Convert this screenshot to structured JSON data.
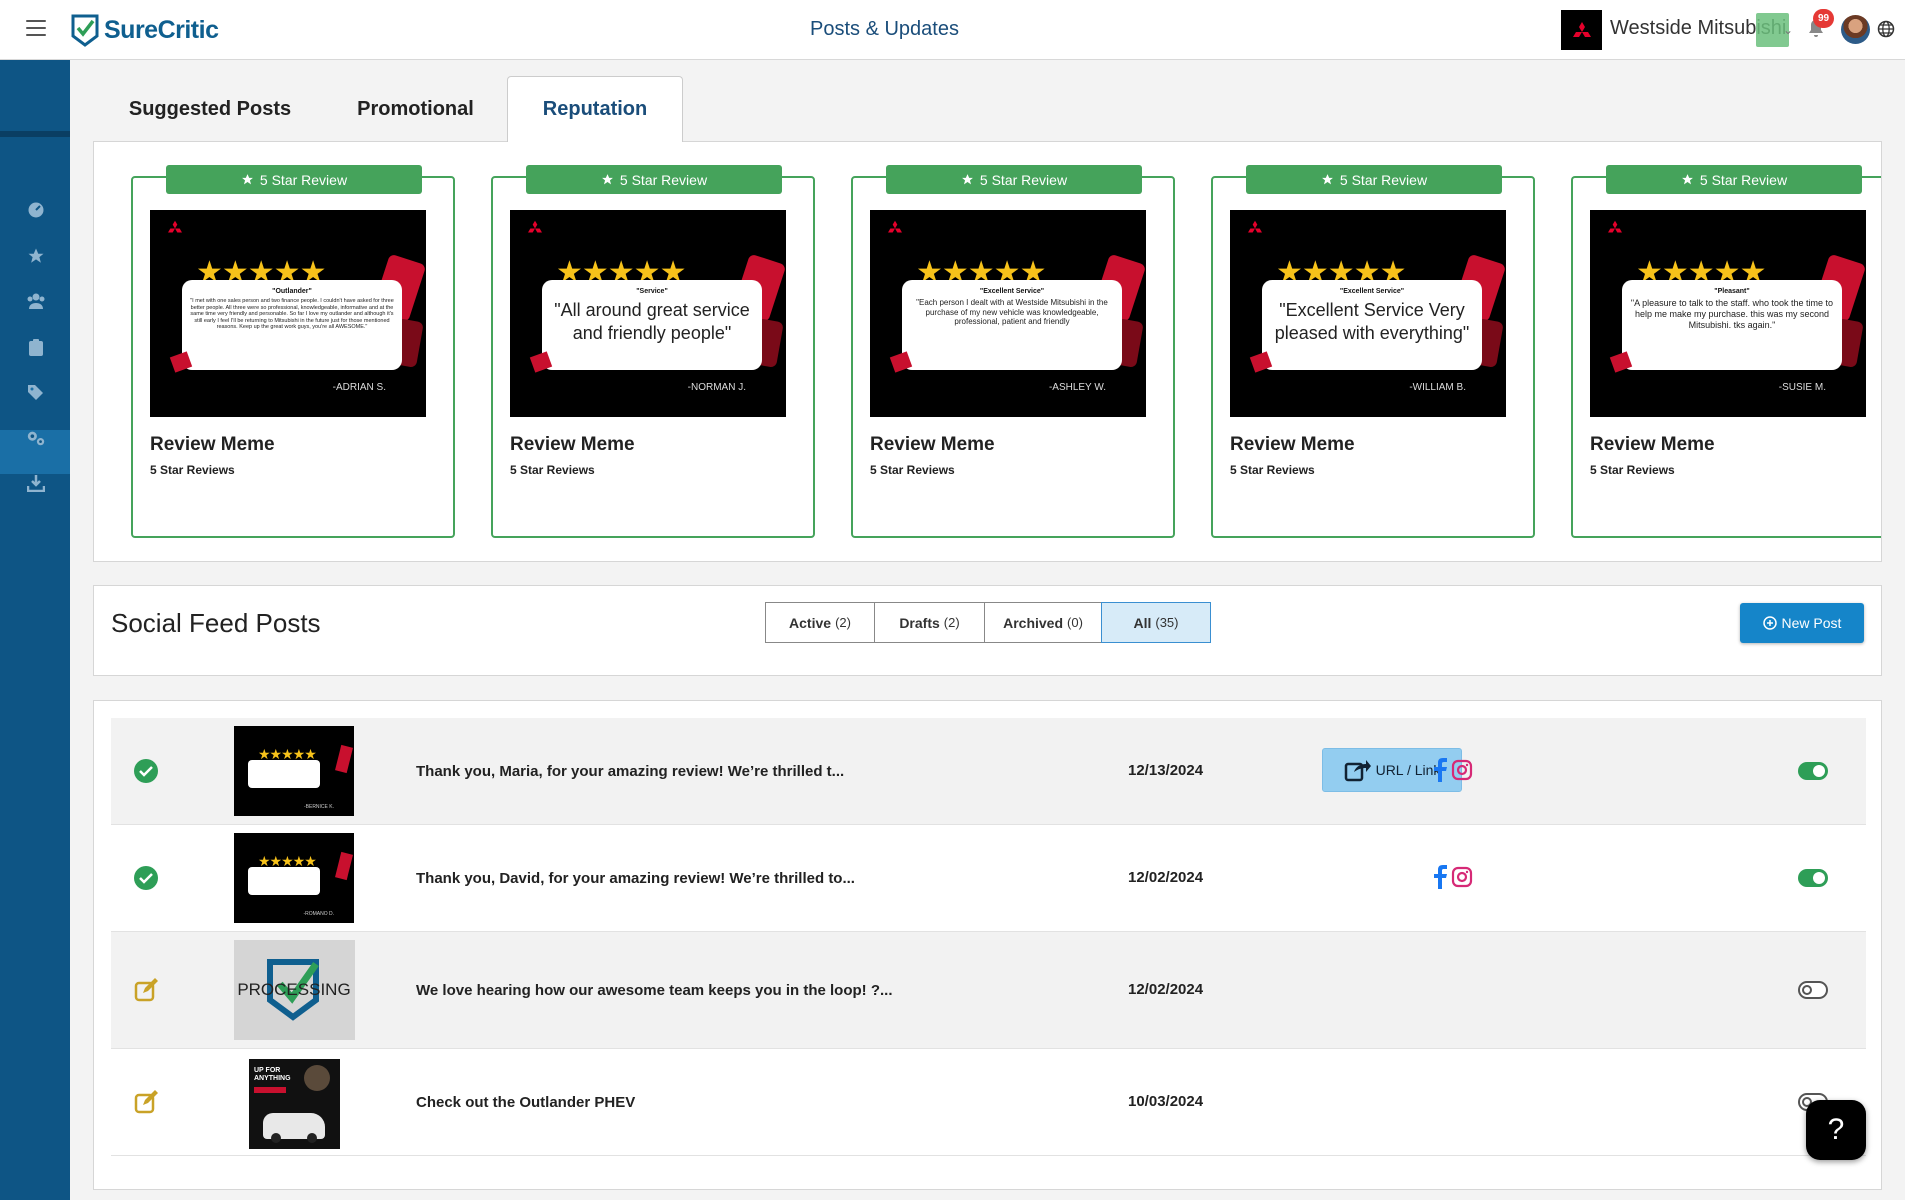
{
  "app": {
    "brand": "SureCritic",
    "page_title": "Posts & Updates",
    "dealer": "Westside Mitsubishi",
    "notif_count": "99"
  },
  "tabs": [
    {
      "label": "Suggested Posts"
    },
    {
      "label": "Promotional"
    },
    {
      "label": "Reputation"
    }
  ],
  "cards": [
    {
      "tag": "5 Star Review",
      "meme_title": "\"Outlander\"",
      "meme_body": "\"I met with one sales person and two finance people. I couldn't have asked for three better people. All three were so professional, knowledgeable, informative and at the same time very friendly and personable. So far I love my outlander and although it's still early I feel I'll be returning to Mitsubishi in the future just for those mentioned reasons. Keep up the great work guys, you're all AWESOME.\"",
      "author": "-ADRIAN S.",
      "title": "Review Meme",
      "sub": "5 Star Reviews"
    },
    {
      "tag": "5 Star Review",
      "meme_title": "\"Service\"",
      "meme_body": "\"All around great service and friendly people\"",
      "author": "-NORMAN J.",
      "title": "Review Meme",
      "sub": "5 Star Reviews"
    },
    {
      "tag": "5 Star Review",
      "meme_title": "\"Excellent Service\"",
      "meme_body": "\"Each person I dealt with at Westside Mitsubishi in the purchase of my new vehicle was knowledgeable, professional, patient and friendly",
      "author": "-ASHLEY W.",
      "title": "Review Meme",
      "sub": "5 Star Reviews"
    },
    {
      "tag": "5 Star Review",
      "meme_title": "\"Excellent Service\"",
      "meme_body": "\"Excellent Service Very pleased with everything\"",
      "author": "-WILLIAM B.",
      "title": "Review Meme",
      "sub": "5 Star Reviews"
    },
    {
      "tag": "5 Star Review",
      "meme_title": "\"Pleasant\"",
      "meme_body": "\"A pleasure to talk to the staff. who took the time to help me make my purchase. this was my second Mitsubishi. tks again.\"",
      "author": "-SUSIE M.",
      "title": "Review Meme",
      "sub": "5 Star Reviews"
    }
  ],
  "feed": {
    "title": "Social Feed Posts",
    "filters": [
      {
        "label": "Active",
        "count": "(2)"
      },
      {
        "label": "Drafts",
        "count": "(2)"
      },
      {
        "label": "Archived",
        "count": "(0)"
      },
      {
        "label": "All",
        "count": "(35)"
      }
    ],
    "new_post": "New Post",
    "url_link": "URL / Link",
    "rows": [
      {
        "text": "Thank you, Maria, for your amazing review! We’re thrilled t...",
        "date": "12/13/2024",
        "status": "active",
        "toggle": "on",
        "thumb_author": "-BERNICE K."
      },
      {
        "text": "Thank you, David, for your amazing review! We’re thrilled to...",
        "date": "12/02/2024",
        "status": "active",
        "toggle": "on",
        "thumb_author": "-ROMANO D."
      },
      {
        "text": "We love hearing how our awesome team keeps you in the loop! ?...",
        "date": "12/02/2024",
        "status": "draft",
        "toggle": "off",
        "thumb_label": "PROCESSING"
      },
      {
        "text": "Check out the Outlander PHEV",
        "date": "10/03/2024",
        "status": "draft",
        "toggle": "off",
        "thumb_label": "UP FOR ANYTHING"
      }
    ]
  },
  "help": "?",
  "colors": {
    "brand_blue": "#0e5585",
    "review_green": "#45a35b",
    "active_green": "#2e9e57",
    "draft_gold": "#c9a227",
    "primary_button": "#1585c9"
  }
}
